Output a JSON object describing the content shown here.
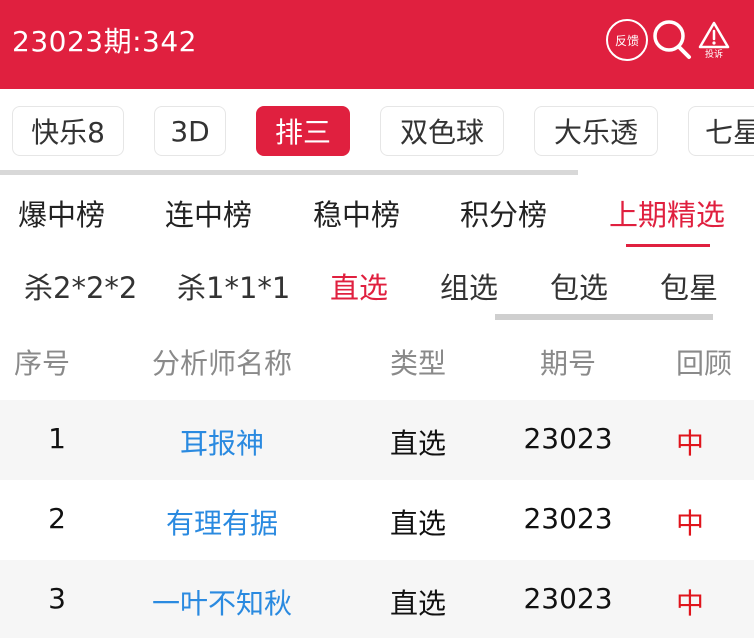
{
  "header": {
    "title": "23023期:342",
    "feedback_label": "反馈",
    "report_label": "投诉"
  },
  "lottery_tabs": [
    "快乐8",
    "3D",
    "排三",
    "双色球",
    "大乐透",
    "七星彩"
  ],
  "lottery_active": "排三",
  "rank_tabs": [
    "爆中榜",
    "连中榜",
    "稳中榜",
    "积分榜",
    "上期精选"
  ],
  "rank_active": "上期精选",
  "sub_tabs": [
    "杀2*2*2",
    "杀1*1*1",
    "直选",
    "组选",
    "包选",
    "包星"
  ],
  "sub_active": "直选",
  "table": {
    "headers": [
      "序号",
      "分析师名称",
      "类型",
      "期号",
      "回顾"
    ],
    "rows": [
      {
        "index": "1",
        "name": "耳报神",
        "type": "直选",
        "period": "23023",
        "result": "中"
      },
      {
        "index": "2",
        "name": "有理有据",
        "type": "直选",
        "period": "23023",
        "result": "中"
      },
      {
        "index": "3",
        "name": "一叶不知秋",
        "type": "直选",
        "period": "23023",
        "result": "中"
      }
    ]
  },
  "colors": {
    "brand": "#e0203f",
    "link": "#2a8ae0",
    "hit": "#e0141c"
  }
}
